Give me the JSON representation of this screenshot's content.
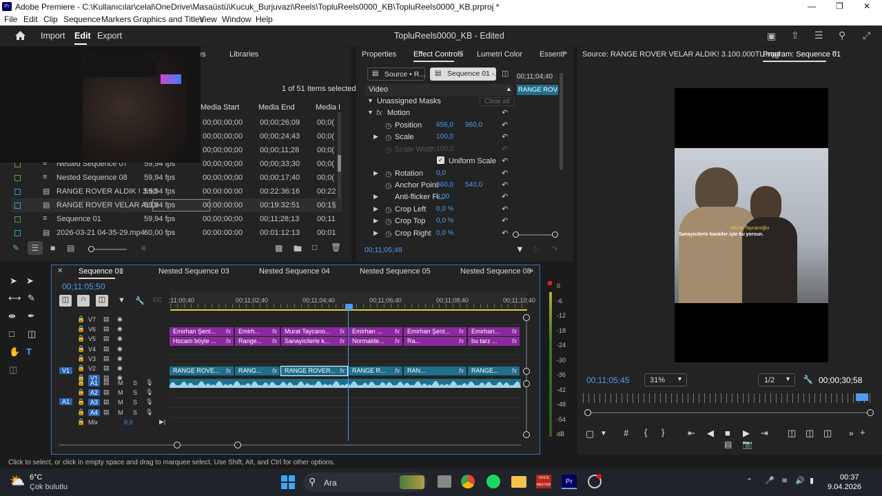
{
  "window": {
    "title": "Adobe Premiere - C:\\Kullanıcılar\\celal\\OneDrive\\Masaüstü\\Kucuk_Burjuvazi\\Reels\\TopluReels0000_KB\\TopluReels0000_KB.prproj *",
    "app_icon": "Pr"
  },
  "menu": [
    "File",
    "Edit",
    "Clip",
    "Sequence",
    "Markers",
    "Graphics and Titles",
    "View",
    "Window",
    "Help"
  ],
  "appbar": {
    "import": "Import",
    "edit": "Edit",
    "export": "Export",
    "project_title": "TopluReels0000_KB - Edited"
  },
  "project": {
    "tabs": {
      "partial": "es",
      "libraries": "Libraries"
    },
    "selection": "1 of 51 Items selected",
    "columns": [
      "Media Start",
      "Media End",
      "Media I"
    ],
    "rows": [
      {
        "name": "",
        "fps": "",
        "start": "00;00;00;00",
        "end": "00;00;26;09",
        "dur": "00;0(",
        "color": "#c9b437"
      },
      {
        "name": "",
        "fps": "",
        "start": "00;00;00;00",
        "end": "00;00;24;43",
        "dur": "00;0(",
        "color": "#c9b437"
      },
      {
        "name": "",
        "fps": "",
        "start": "00;00;00;00",
        "end": "00;00;11;28",
        "dur": "00;0(",
        "color": "#c9b437"
      },
      {
        "name": "Nested Sequence 07",
        "fps": "59,94 fps",
        "start": "00;00;00;00",
        "end": "00;00;33;30",
        "dur": "00;0(",
        "color": "#6e9a3e"
      },
      {
        "name": "Nested Sequence 08",
        "fps": "59,94 fps",
        "start": "00;00;00;00",
        "end": "00;00;17;40",
        "dur": "00;0(",
        "color": "#6e9a3e"
      },
      {
        "name": "RANGE ROVER ALDIK ! 3.50",
        "fps": "59,94 fps",
        "start": "00:00:00:00",
        "end": "00:22:36:16",
        "dur": "00:22",
        "color": "#2aa0b8"
      },
      {
        "name": "RANGE ROVER VELAR ALDI",
        "fps": "59,94 fps",
        "start": "00:00:00:00",
        "end": "00:19:32:51",
        "dur": "00:1§",
        "color": "#2aa0b8"
      },
      {
        "name": "Sequence 01",
        "fps": "59,94 fps",
        "start": "00;00;00;00",
        "end": "00;11;28;13",
        "dur": "00;11",
        "color": "#6e9a3e"
      },
      {
        "name": "2026-03-21 04-35-29.mp4",
        "fps": "60,00 fps",
        "start": "00:00:00:00",
        "end": "00:01:12:13",
        "dur": "00:01",
        "color": "#2aa0b8"
      }
    ]
  },
  "effect_controls": {
    "tabs": [
      "Properties",
      "Effect Controls",
      "Lumetri Color",
      "Essenti"
    ],
    "source_btn": "Source • R...",
    "seq_btn": "Sequence 01 -...",
    "mini_time": "00;11;04;40",
    "mini_clip": "RANGE ROVER",
    "video_label": "Video",
    "unassigned": "Unassigned Masks",
    "clear_all": "Clear all",
    "motion": "Motion",
    "params": [
      {
        "name": "Position",
        "v1": "656,0",
        "v2": "960,0"
      },
      {
        "name": "Scale",
        "v1": "100,0",
        "v2": ""
      },
      {
        "name": "Scale Width",
        "v1": "100,0",
        "v2": ""
      },
      {
        "name": "Uniform Scale",
        "v1": "",
        "v2": ""
      },
      {
        "name": "Rotation",
        "v1": "0,0",
        "v2": ""
      },
      {
        "name": "Anchor Point",
        "v1": "960,0",
        "v2": "540,0"
      },
      {
        "name": "Anti-flicker Fi...",
        "v1": "0,00",
        "v2": ""
      },
      {
        "name": "Crop Left",
        "v1": "0,0 %",
        "v2": ""
      },
      {
        "name": "Crop Top",
        "v1": "0,0 %",
        "v2": ""
      },
      {
        "name": "Crop Right",
        "v1": "0,0 %",
        "v2": ""
      }
    ],
    "timecode": "00;11;05;48"
  },
  "monitor": {
    "source_tab": "Source: RANGE ROVER VELAR ALDIK! 3.100.000TL.mp4",
    "program_tab": "Program: Sequence 01",
    "subtitle_name": "Murat Taycanoğlu",
    "subtitle_text": "Sanayicilerle kankiler işte bu yorsun.",
    "timecode": "00;11;05;45",
    "zoom": "31%",
    "res": "1/2",
    "duration": "00;00;30;58"
  },
  "timeline": {
    "tabs": [
      "Sequence 01",
      "Nested Sequence 03",
      "Nested Sequence 04",
      "Nested Sequence 05",
      "Nested Sequence 08"
    ],
    "timecode": "00;11;05;50",
    "ruler": [
      ";11;00;40",
      "00;11;02;40",
      "00;11;04;40",
      "00;11;06;40",
      "00;11;08;40",
      "00;11;10;40"
    ],
    "video_tracks": [
      "V7",
      "V6",
      "V5",
      "V4",
      "V3",
      "V2",
      "V1"
    ],
    "audio_tracks": [
      "A1",
      "A2",
      "A3",
      "A4"
    ],
    "mix_label": "Mix",
    "mix_value": "0,0",
    "src_v1": "V1",
    "src_a1": "A1",
    "m": "M",
    "s": "S",
    "v5_clips": [
      "Emirhan Şent...",
      "Emirh...",
      "Murat Taycano...",
      "Emirhan ...",
      "Emirhan Şent...",
      "Emirhan..."
    ],
    "v4_clips": [
      "Hocam böyle ...",
      "Range...",
      "Sanayicilerle k...",
      "Normalde...",
      "Ra...",
      "bu tarz ..."
    ],
    "v1_clips": [
      "RANGE ROVE...",
      "RANG...",
      "RANGE ROVER...",
      "RANGE R...",
      "RAN...",
      "RANGE..."
    ],
    "fx": "fx"
  },
  "meter": {
    "scale": [
      "0",
      "-6",
      "-12",
      "-18",
      "-24",
      "-30",
      "-36",
      "-42",
      "-48",
      "-54",
      "dB"
    ]
  },
  "status": "Click to select, or click in empty space and drag to marquee select. Use Shift, Alt, and Ctrl for other options.",
  "taskbar": {
    "temp": "6°C",
    "weather": "Çok bulutlu",
    "search": "Ara",
    "time": "00:37",
    "date": "9.04.2026",
    "voice": "VOICE MEETER"
  }
}
